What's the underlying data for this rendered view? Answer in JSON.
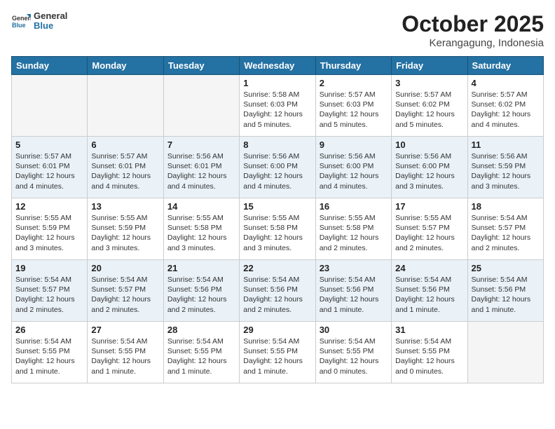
{
  "header": {
    "logo_general": "General",
    "logo_blue": "Blue",
    "title": "October 2025",
    "subtitle": "Kerangagung, Indonesia"
  },
  "days_of_week": [
    "Sunday",
    "Monday",
    "Tuesday",
    "Wednesday",
    "Thursday",
    "Friday",
    "Saturday"
  ],
  "weeks": [
    [
      {
        "day": "",
        "empty": true
      },
      {
        "day": "",
        "empty": true
      },
      {
        "day": "",
        "empty": true
      },
      {
        "day": "1",
        "sunrise": "Sunrise: 5:58 AM",
        "sunset": "Sunset: 6:03 PM",
        "daylight": "Daylight: 12 hours and 5 minutes."
      },
      {
        "day": "2",
        "sunrise": "Sunrise: 5:57 AM",
        "sunset": "Sunset: 6:03 PM",
        "daylight": "Daylight: 12 hours and 5 minutes."
      },
      {
        "day": "3",
        "sunrise": "Sunrise: 5:57 AM",
        "sunset": "Sunset: 6:02 PM",
        "daylight": "Daylight: 12 hours and 5 minutes."
      },
      {
        "day": "4",
        "sunrise": "Sunrise: 5:57 AM",
        "sunset": "Sunset: 6:02 PM",
        "daylight": "Daylight: 12 hours and 4 minutes."
      }
    ],
    [
      {
        "day": "5",
        "sunrise": "Sunrise: 5:57 AM",
        "sunset": "Sunset: 6:01 PM",
        "daylight": "Daylight: 12 hours and 4 minutes."
      },
      {
        "day": "6",
        "sunrise": "Sunrise: 5:57 AM",
        "sunset": "Sunset: 6:01 PM",
        "daylight": "Daylight: 12 hours and 4 minutes."
      },
      {
        "day": "7",
        "sunrise": "Sunrise: 5:56 AM",
        "sunset": "Sunset: 6:01 PM",
        "daylight": "Daylight: 12 hours and 4 minutes."
      },
      {
        "day": "8",
        "sunrise": "Sunrise: 5:56 AM",
        "sunset": "Sunset: 6:00 PM",
        "daylight": "Daylight: 12 hours and 4 minutes."
      },
      {
        "day": "9",
        "sunrise": "Sunrise: 5:56 AM",
        "sunset": "Sunset: 6:00 PM",
        "daylight": "Daylight: 12 hours and 4 minutes."
      },
      {
        "day": "10",
        "sunrise": "Sunrise: 5:56 AM",
        "sunset": "Sunset: 6:00 PM",
        "daylight": "Daylight: 12 hours and 3 minutes."
      },
      {
        "day": "11",
        "sunrise": "Sunrise: 5:56 AM",
        "sunset": "Sunset: 5:59 PM",
        "daylight": "Daylight: 12 hours and 3 minutes."
      }
    ],
    [
      {
        "day": "12",
        "sunrise": "Sunrise: 5:55 AM",
        "sunset": "Sunset: 5:59 PM",
        "daylight": "Daylight: 12 hours and 3 minutes."
      },
      {
        "day": "13",
        "sunrise": "Sunrise: 5:55 AM",
        "sunset": "Sunset: 5:59 PM",
        "daylight": "Daylight: 12 hours and 3 minutes."
      },
      {
        "day": "14",
        "sunrise": "Sunrise: 5:55 AM",
        "sunset": "Sunset: 5:58 PM",
        "daylight": "Daylight: 12 hours and 3 minutes."
      },
      {
        "day": "15",
        "sunrise": "Sunrise: 5:55 AM",
        "sunset": "Sunset: 5:58 PM",
        "daylight": "Daylight: 12 hours and 3 minutes."
      },
      {
        "day": "16",
        "sunrise": "Sunrise: 5:55 AM",
        "sunset": "Sunset: 5:58 PM",
        "daylight": "Daylight: 12 hours and 2 minutes."
      },
      {
        "day": "17",
        "sunrise": "Sunrise: 5:55 AM",
        "sunset": "Sunset: 5:57 PM",
        "daylight": "Daylight: 12 hours and 2 minutes."
      },
      {
        "day": "18",
        "sunrise": "Sunrise: 5:54 AM",
        "sunset": "Sunset: 5:57 PM",
        "daylight": "Daylight: 12 hours and 2 minutes."
      }
    ],
    [
      {
        "day": "19",
        "sunrise": "Sunrise: 5:54 AM",
        "sunset": "Sunset: 5:57 PM",
        "daylight": "Daylight: 12 hours and 2 minutes."
      },
      {
        "day": "20",
        "sunrise": "Sunrise: 5:54 AM",
        "sunset": "Sunset: 5:57 PM",
        "daylight": "Daylight: 12 hours and 2 minutes."
      },
      {
        "day": "21",
        "sunrise": "Sunrise: 5:54 AM",
        "sunset": "Sunset: 5:56 PM",
        "daylight": "Daylight: 12 hours and 2 minutes."
      },
      {
        "day": "22",
        "sunrise": "Sunrise: 5:54 AM",
        "sunset": "Sunset: 5:56 PM",
        "daylight": "Daylight: 12 hours and 2 minutes."
      },
      {
        "day": "23",
        "sunrise": "Sunrise: 5:54 AM",
        "sunset": "Sunset: 5:56 PM",
        "daylight": "Daylight: 12 hours and 1 minute."
      },
      {
        "day": "24",
        "sunrise": "Sunrise: 5:54 AM",
        "sunset": "Sunset: 5:56 PM",
        "daylight": "Daylight: 12 hours and 1 minute."
      },
      {
        "day": "25",
        "sunrise": "Sunrise: 5:54 AM",
        "sunset": "Sunset: 5:56 PM",
        "daylight": "Daylight: 12 hours and 1 minute."
      }
    ],
    [
      {
        "day": "26",
        "sunrise": "Sunrise: 5:54 AM",
        "sunset": "Sunset: 5:55 PM",
        "daylight": "Daylight: 12 hours and 1 minute."
      },
      {
        "day": "27",
        "sunrise": "Sunrise: 5:54 AM",
        "sunset": "Sunset: 5:55 PM",
        "daylight": "Daylight: 12 hours and 1 minute."
      },
      {
        "day": "28",
        "sunrise": "Sunrise: 5:54 AM",
        "sunset": "Sunset: 5:55 PM",
        "daylight": "Daylight: 12 hours and 1 minute."
      },
      {
        "day": "29",
        "sunrise": "Sunrise: 5:54 AM",
        "sunset": "Sunset: 5:55 PM",
        "daylight": "Daylight: 12 hours and 1 minute."
      },
      {
        "day": "30",
        "sunrise": "Sunrise: 5:54 AM",
        "sunset": "Sunset: 5:55 PM",
        "daylight": "Daylight: 12 hours and 0 minutes."
      },
      {
        "day": "31",
        "sunrise": "Sunrise: 5:54 AM",
        "sunset": "Sunset: 5:55 PM",
        "daylight": "Daylight: 12 hours and 0 minutes."
      },
      {
        "day": "",
        "empty": true
      }
    ]
  ]
}
